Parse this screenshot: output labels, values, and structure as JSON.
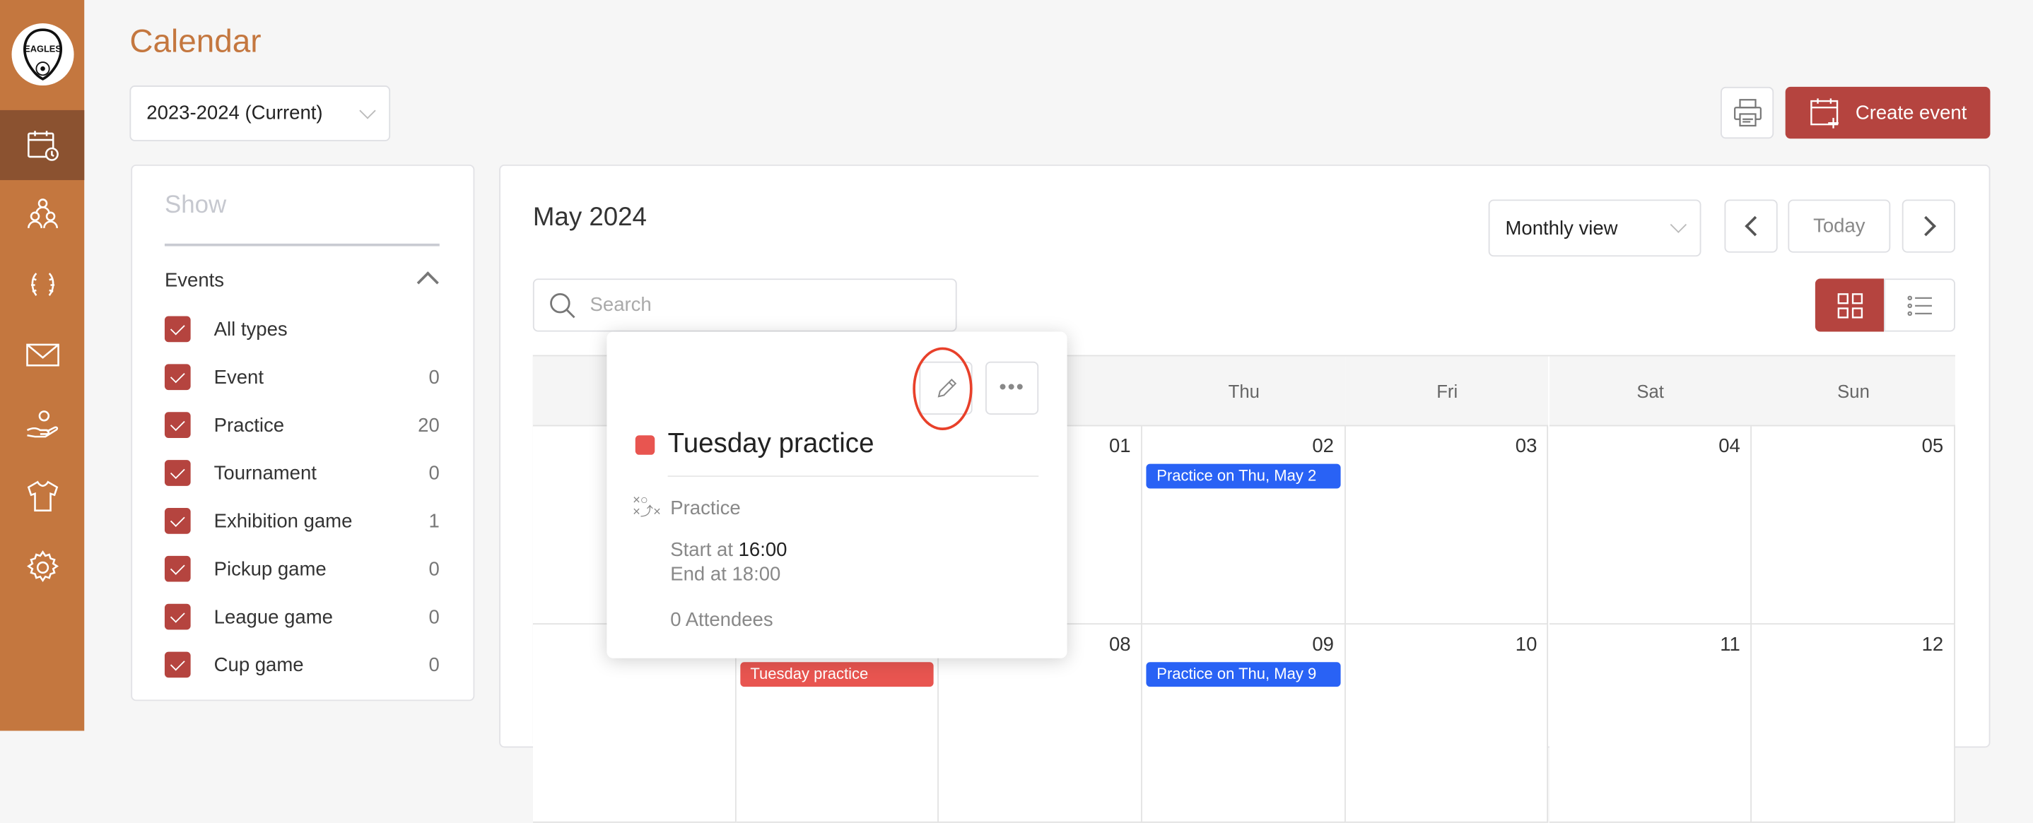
{
  "app": {
    "logo_text": "EAGLES"
  },
  "sidebar": {
    "items": [
      {
        "name": "calendar",
        "icon": "calendar-clock-icon",
        "active": true
      },
      {
        "name": "teams",
        "icon": "people-group-icon"
      },
      {
        "name": "awards",
        "icon": "laurel-icon"
      },
      {
        "name": "messages",
        "icon": "envelope-icon"
      },
      {
        "name": "sponsors",
        "icon": "hand-person-icon"
      },
      {
        "name": "equipment",
        "icon": "jersey-icon"
      },
      {
        "name": "settings",
        "icon": "gear-icon"
      }
    ]
  },
  "header": {
    "title": "Calendar",
    "season": "2023-2024 (Current)",
    "create_label": "Create event"
  },
  "filters": {
    "title": "Show",
    "section": "Events",
    "items": [
      {
        "label": "All types",
        "count": "",
        "checked": true
      },
      {
        "label": "Event",
        "count": "0",
        "checked": true
      },
      {
        "label": "Practice",
        "count": "20",
        "checked": true
      },
      {
        "label": "Tournament",
        "count": "0",
        "checked": true
      },
      {
        "label": "Exhibition game",
        "count": "1",
        "checked": true
      },
      {
        "label": "Pickup game",
        "count": "0",
        "checked": true
      },
      {
        "label": "League game",
        "count": "0",
        "checked": true
      },
      {
        "label": "Cup game",
        "count": "0",
        "checked": true
      }
    ]
  },
  "calendar": {
    "month": "May 2024",
    "view": "Monthly view",
    "today_label": "Today",
    "search_placeholder": "Search",
    "weekdays": [
      "",
      "",
      "",
      "Thu",
      "Fri",
      "Sat",
      "Sun"
    ],
    "weeks": [
      {
        "days": [
          "",
          "",
          "01",
          "02",
          "03",
          "04",
          "05"
        ],
        "events": {
          "3": {
            "label": "Practice on Thu, May 2",
            "color": "#2962F5"
          }
        }
      },
      {
        "days": [
          "",
          "",
          "08",
          "09",
          "10",
          "11",
          "12"
        ],
        "events": {
          "1": {
            "label": "Tuesday practice",
            "color": "#E85550"
          },
          "3": {
            "label": "Practice on Thu, May 9",
            "color": "#2962F5"
          }
        }
      }
    ]
  },
  "popup": {
    "title": "Tuesday practice",
    "color": "#E85550",
    "type": "Practice",
    "start_label": "Start at",
    "start": "16:00",
    "end": "End at 18:00",
    "attendees": "0 Attendees"
  },
  "colors": {
    "brand": "#C4773F",
    "accent": "#B5443F",
    "highlight_ring": "#E8402A"
  }
}
